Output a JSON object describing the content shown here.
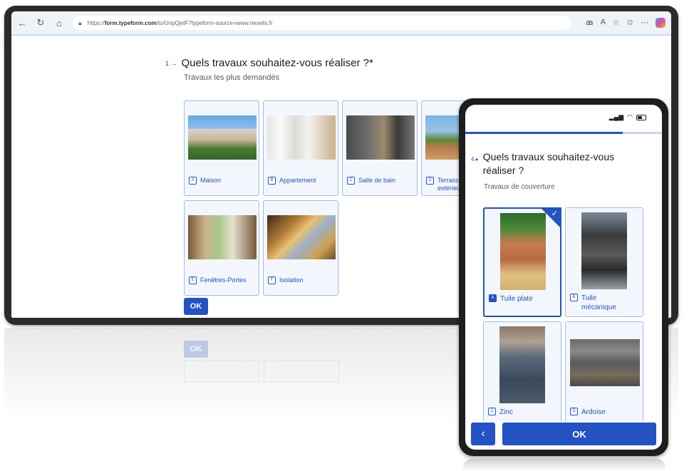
{
  "browser": {
    "url_prefix": "https://",
    "url_domain": "form.typeform.com",
    "url_path": "/to/UnpQjelF?typeform-source=www.nexelis.fr"
  },
  "desktop": {
    "question_number": "1 →",
    "question": "Quels travaux souhaitez-vous réaliser ?*",
    "subtitle": "Travaux les plus demandés",
    "options": [
      {
        "key": "A",
        "label": "Maison"
      },
      {
        "key": "B",
        "label": "Appartement"
      },
      {
        "key": "C",
        "label": "Salle de bain"
      },
      {
        "key": "D",
        "label": "Terrasse extérieure"
      },
      {
        "key": "E",
        "label": "Fenêtres-Portes"
      },
      {
        "key": "F",
        "label": "Isolation"
      }
    ],
    "ok_label": "OK"
  },
  "mobile": {
    "progress": 0.8,
    "question_number": "4 ▸",
    "question": "Quels travaux souhaitez-vous réaliser ?",
    "subtitle": "Travaux de couverture",
    "options": [
      {
        "key": "A",
        "label": "Tuile plate",
        "selected": true
      },
      {
        "key": "B",
        "label": "Tuile mécanique"
      },
      {
        "key": "C",
        "label": "Zinc"
      },
      {
        "key": "D",
        "label": "Ardoise"
      }
    ],
    "back_label": "‹",
    "ok_label": "OK"
  },
  "colors": {
    "accent": "#2252c4",
    "card_border": "#9fbbe6",
    "card_bg": "#f3f7fd"
  }
}
